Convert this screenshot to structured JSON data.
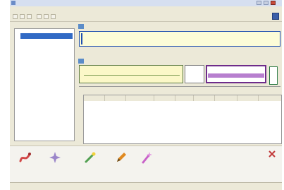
{
  "window": {
    "title": ""
  },
  "page": {
    "sidebar_label": ""
  },
  "menu": [
    "",
    "",
    "",
    "",
    "",
    ""
  ],
  "tree": {
    "items": [
      {
        "label": ""
      },
      {
        "label": ""
      },
      {
        "label": ""
      },
      {
        "label": ""
      },
      {
        "label": ""
      },
      {
        "label": ""
      },
      {
        "label": ""
      },
      {
        "label": ""
      },
      {
        "label": ""
      }
    ]
  },
  "panels": [
    {
      "header": "",
      "rows": [
        "",
        ""
      ]
    },
    {
      "header": "",
      "rows": [
        "",
        ""
      ]
    }
  ],
  "table": {
    "columns": [
      "",
      "",
      "",
      "",
      "",
      "",
      "",
      "",
      ""
    ],
    "rows": [
      [
        "",
        "",
        "",
        "",
        "",
        "",
        "",
        "",
        ""
      ],
      [
        "",
        "",
        "",
        "",
        "",
        "",
        "",
        "",
        ""
      ],
      [
        "",
        "",
        "",
        "",
        "",
        "",
        "",
        "",
        ""
      ]
    ]
  },
  "actions": [
    {
      "label": "",
      "icon": "snake-icon",
      "color": "#d24848"
    },
    {
      "label": "",
      "icon": "sparkle-icon",
      "color": "#9b86c9"
    },
    {
      "label": "",
      "icon": "wand-icon",
      "color": "#52a052"
    },
    {
      "label": "",
      "icon": "pencil-icon",
      "color": "#e08a20"
    },
    {
      "label": "",
      "icon": "magic-icon",
      "color": "#c862c8"
    }
  ],
  "statusbar": [
    "",
    "",
    "",
    "",
    "",
    "",
    "",
    ""
  ],
  "colors": {
    "accent": "#316ac5",
    "selection_fill": "#b77fcf",
    "selection_border": "#6e2c8a",
    "panel_fill": "#fcfcd8"
  }
}
